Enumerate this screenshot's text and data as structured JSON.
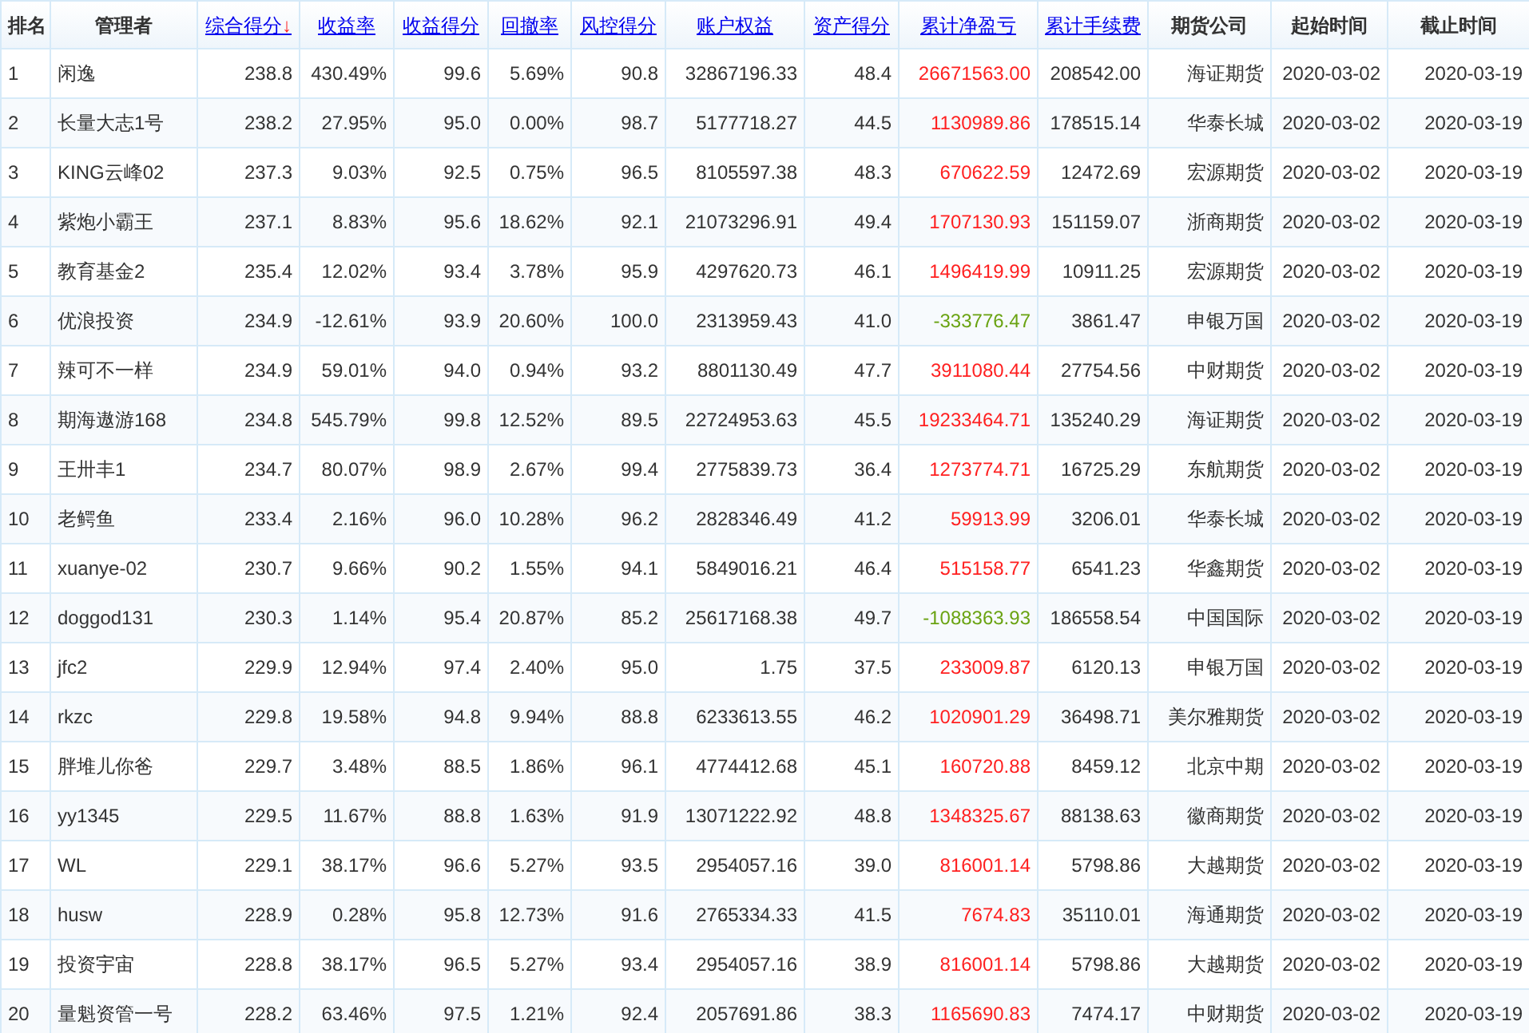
{
  "table": {
    "columns": [
      {
        "label": "排名",
        "link": false
      },
      {
        "label": "管理者",
        "link": false
      },
      {
        "label": "综合得分",
        "link": true,
        "sort_mark": "↓"
      },
      {
        "label": "收益率",
        "link": true
      },
      {
        "label": "收益得分",
        "link": true
      },
      {
        "label": "回撤率",
        "link": true
      },
      {
        "label": "风控得分",
        "link": true
      },
      {
        "label": "账户权益",
        "link": true
      },
      {
        "label": "资产得分",
        "link": true
      },
      {
        "label": "累计净盈亏",
        "link": true
      },
      {
        "label": "累计手续费",
        "link": true
      },
      {
        "label": "期货公司",
        "link": false
      },
      {
        "label": "起始时间",
        "link": false
      },
      {
        "label": "截止时间",
        "link": false
      }
    ],
    "rows": [
      {
        "loss": false,
        "cells": [
          "1",
          "闲逸",
          "238.8",
          "430.49%",
          "99.6",
          "5.69%",
          "90.8",
          "32867196.33",
          "48.4",
          "26671563.00",
          "208542.00",
          "海证期货",
          "2020-03-02",
          "2020-03-19"
        ]
      },
      {
        "loss": false,
        "cells": [
          "2",
          "长量大志1号",
          "238.2",
          "27.95%",
          "95.0",
          "0.00%",
          "98.7",
          "5177718.27",
          "44.5",
          "1130989.86",
          "178515.14",
          "华泰长城",
          "2020-03-02",
          "2020-03-19"
        ]
      },
      {
        "loss": false,
        "cells": [
          "3",
          "KING云峰02",
          "237.3",
          "9.03%",
          "92.5",
          "0.75%",
          "96.5",
          "8105597.38",
          "48.3",
          "670622.59",
          "12472.69",
          "宏源期货",
          "2020-03-02",
          "2020-03-19"
        ]
      },
      {
        "loss": false,
        "cells": [
          "4",
          "紫炮小霸王",
          "237.1",
          "8.83%",
          "95.6",
          "18.62%",
          "92.1",
          "21073296.91",
          "49.4",
          "1707130.93",
          "151159.07",
          "浙商期货",
          "2020-03-02",
          "2020-03-19"
        ]
      },
      {
        "loss": false,
        "cells": [
          "5",
          "教育基金2",
          "235.4",
          "12.02%",
          "93.4",
          "3.78%",
          "95.9",
          "4297620.73",
          "46.1",
          "1496419.99",
          "10911.25",
          "宏源期货",
          "2020-03-02",
          "2020-03-19"
        ]
      },
      {
        "loss": true,
        "cells": [
          "6",
          "优浪投资",
          "234.9",
          "-12.61%",
          "93.9",
          "20.60%",
          "100.0",
          "2313959.43",
          "41.0",
          "-333776.47",
          "3861.47",
          "申银万国",
          "2020-03-02",
          "2020-03-19"
        ]
      },
      {
        "loss": false,
        "cells": [
          "7",
          "辣可不一样",
          "234.9",
          "59.01%",
          "94.0",
          "0.94%",
          "93.2",
          "8801130.49",
          "47.7",
          "3911080.44",
          "27754.56",
          "中财期货",
          "2020-03-02",
          "2020-03-19"
        ]
      },
      {
        "loss": false,
        "cells": [
          "8",
          "期海遨游168",
          "234.8",
          "545.79%",
          "99.8",
          "12.52%",
          "89.5",
          "22724953.63",
          "45.5",
          "19233464.71",
          "135240.29",
          "海证期货",
          "2020-03-02",
          "2020-03-19"
        ]
      },
      {
        "loss": false,
        "cells": [
          "9",
          "王卅丰1",
          "234.7",
          "80.07%",
          "98.9",
          "2.67%",
          "99.4",
          "2775839.73",
          "36.4",
          "1273774.71",
          "16725.29",
          "东航期货",
          "2020-03-02",
          "2020-03-19"
        ]
      },
      {
        "loss": false,
        "cells": [
          "10",
          "老鳄鱼",
          "233.4",
          "2.16%",
          "96.0",
          "10.28%",
          "96.2",
          "2828346.49",
          "41.2",
          "59913.99",
          "3206.01",
          "华泰长城",
          "2020-03-02",
          "2020-03-19"
        ]
      },
      {
        "loss": false,
        "cells": [
          "11",
          "xuanye-02",
          "230.7",
          "9.66%",
          "90.2",
          "1.55%",
          "94.1",
          "5849016.21",
          "46.4",
          "515158.77",
          "6541.23",
          "华鑫期货",
          "2020-03-02",
          "2020-03-19"
        ]
      },
      {
        "loss": true,
        "cells": [
          "12",
          "doggod131",
          "230.3",
          "1.14%",
          "95.4",
          "20.87%",
          "85.2",
          "25617168.38",
          "49.7",
          "-1088363.93",
          "186558.54",
          "中国国际",
          "2020-03-02",
          "2020-03-19"
        ]
      },
      {
        "loss": false,
        "cells": [
          "13",
          "jfc2",
          "229.9",
          "12.94%",
          "97.4",
          "2.40%",
          "95.0",
          "1.75",
          "37.5",
          "233009.87",
          "6120.13",
          "申银万国",
          "2020-03-02",
          "2020-03-19"
        ]
      },
      {
        "loss": false,
        "cells": [
          "14",
          "rkzc",
          "229.8",
          "19.58%",
          "94.8",
          "9.94%",
          "88.8",
          "6233613.55",
          "46.2",
          "1020901.29",
          "36498.71",
          "美尔雅期货",
          "2020-03-02",
          "2020-03-19"
        ]
      },
      {
        "loss": false,
        "cells": [
          "15",
          "胖堆儿你爸",
          "229.7",
          "3.48%",
          "88.5",
          "1.86%",
          "96.1",
          "4774412.68",
          "45.1",
          "160720.88",
          "8459.12",
          "北京中期",
          "2020-03-02",
          "2020-03-19"
        ]
      },
      {
        "loss": false,
        "cells": [
          "16",
          "yy1345",
          "229.5",
          "11.67%",
          "88.8",
          "1.63%",
          "91.9",
          "13071222.92",
          "48.8",
          "1348325.67",
          "88138.63",
          "徽商期货",
          "2020-03-02",
          "2020-03-19"
        ]
      },
      {
        "loss": false,
        "cells": [
          "17",
          "WL",
          "229.1",
          "38.17%",
          "96.6",
          "5.27%",
          "93.5",
          "2954057.16",
          "39.0",
          "816001.14",
          "5798.86",
          "大越期货",
          "2020-03-02",
          "2020-03-19"
        ]
      },
      {
        "loss": false,
        "cells": [
          "18",
          "husw",
          "228.9",
          "0.28%",
          "95.8",
          "12.73%",
          "91.6",
          "2765334.33",
          "41.5",
          "7674.83",
          "35110.01",
          "海通期货",
          "2020-03-02",
          "2020-03-19"
        ]
      },
      {
        "loss": false,
        "cells": [
          "19",
          "投资宇宙",
          "228.8",
          "38.17%",
          "96.5",
          "5.27%",
          "93.4",
          "2954057.16",
          "38.9",
          "816001.14",
          "5798.86",
          "大越期货",
          "2020-03-02",
          "2020-03-19"
        ]
      },
      {
        "loss": false,
        "cells": [
          "20",
          "量魁资管一号",
          "228.2",
          "63.46%",
          "97.5",
          "1.21%",
          "92.4",
          "2057691.86",
          "38.3",
          "1165690.83",
          "7474.17",
          "中财期货",
          "2020-03-02",
          "2020-03-19"
        ]
      }
    ]
  }
}
